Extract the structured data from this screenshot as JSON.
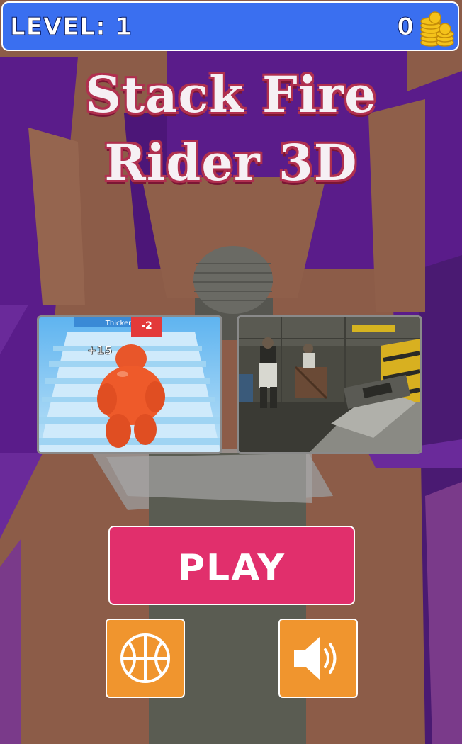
{
  "header": {
    "level_label": "LEVEL: 1",
    "coin_count": "0",
    "coin_icon": "coin-stack-icon"
  },
  "title": {
    "line1": "Stack Fire",
    "line2": "Rider 3D"
  },
  "promos": [
    {
      "name": "promo-runner-game",
      "label_tag": "Thicker",
      "counter": "-2",
      "bonus": "+15"
    },
    {
      "name": "promo-shooter-game"
    }
  ],
  "actions": {
    "play_label": "PLAY",
    "ball_icon": "basketball-icon",
    "sound_icon": "speaker-icon"
  },
  "colors": {
    "topbar": "#3a6ff0",
    "play": "#e12f6c",
    "square_buttons": "#f0952e",
    "purple_walls": "#5a1c8a",
    "ground": "#8a5a45"
  }
}
